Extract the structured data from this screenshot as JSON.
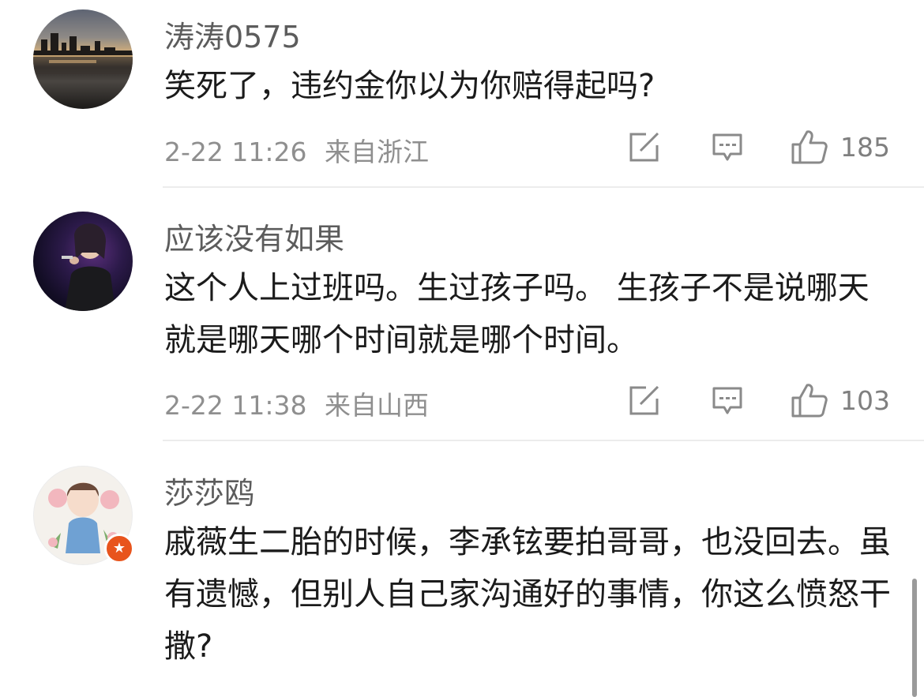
{
  "comments": [
    {
      "username": "涛涛0575",
      "text": "笑死了，违约金你以为你赔得起吗?",
      "time": "2-22 11:26",
      "location": "来自浙江",
      "likes": "185"
    },
    {
      "username": "应该没有如果",
      "text": "这个人上过班吗。生过孩子吗。 生孩子不是说哪天就是哪天哪个时间就是哪个时间。",
      "time": "2-22 11:38",
      "location": "来自山西",
      "likes": "103"
    },
    {
      "username": "莎莎鸥",
      "text": "戚薇生二胎的时候，李承铉要拍哥哥，也没回去。虽有遗憾，但别人自己家沟通好的事情，你这么愤怒干撒?"
    }
  ],
  "icons": {
    "share": "share-icon",
    "comment": "comment-icon",
    "like": "like-icon",
    "badge": "star-badge-icon"
  },
  "colors": {
    "badge": "#e8541c",
    "username": "#5c5c5c",
    "text": "#1b1b1b",
    "meta": "#8f8f8f"
  }
}
